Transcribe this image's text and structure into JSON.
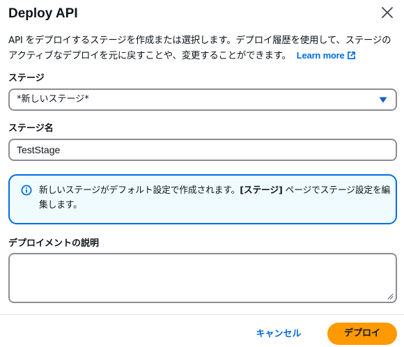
{
  "modal": {
    "title": "Deploy API",
    "description": "API をデプロイするステージを作成または選択します。デプロイ履歴を使用して、ステージのアクティブなデプロイを元に戻すことや、変更することができます。",
    "learn_more": "Learn more"
  },
  "stage_field": {
    "label": "ステージ",
    "selected": "*新しいステージ*"
  },
  "stage_name_field": {
    "label": "ステージ名",
    "value": "TestStage"
  },
  "info_alert": {
    "text_before": "新しいステージがデフォルト設定で作成されます。",
    "bold": "[ステージ]",
    "text_after": " ページでステージ設定を編集します。"
  },
  "description_field": {
    "label": "デプロイメントの説明",
    "value": ""
  },
  "footer": {
    "cancel_label": "キャンセル",
    "deploy_label": "デプロイ"
  },
  "colors": {
    "link": "#006ce0",
    "primary_button": "#ff9900",
    "info_border": "#006ce0",
    "info_background": "#f0fbff"
  },
  "icons": {
    "close": "close-icon",
    "external": "external-link-icon",
    "caret": "caret-down-icon",
    "info": "info-icon",
    "resize": "resize-grip-icon"
  }
}
